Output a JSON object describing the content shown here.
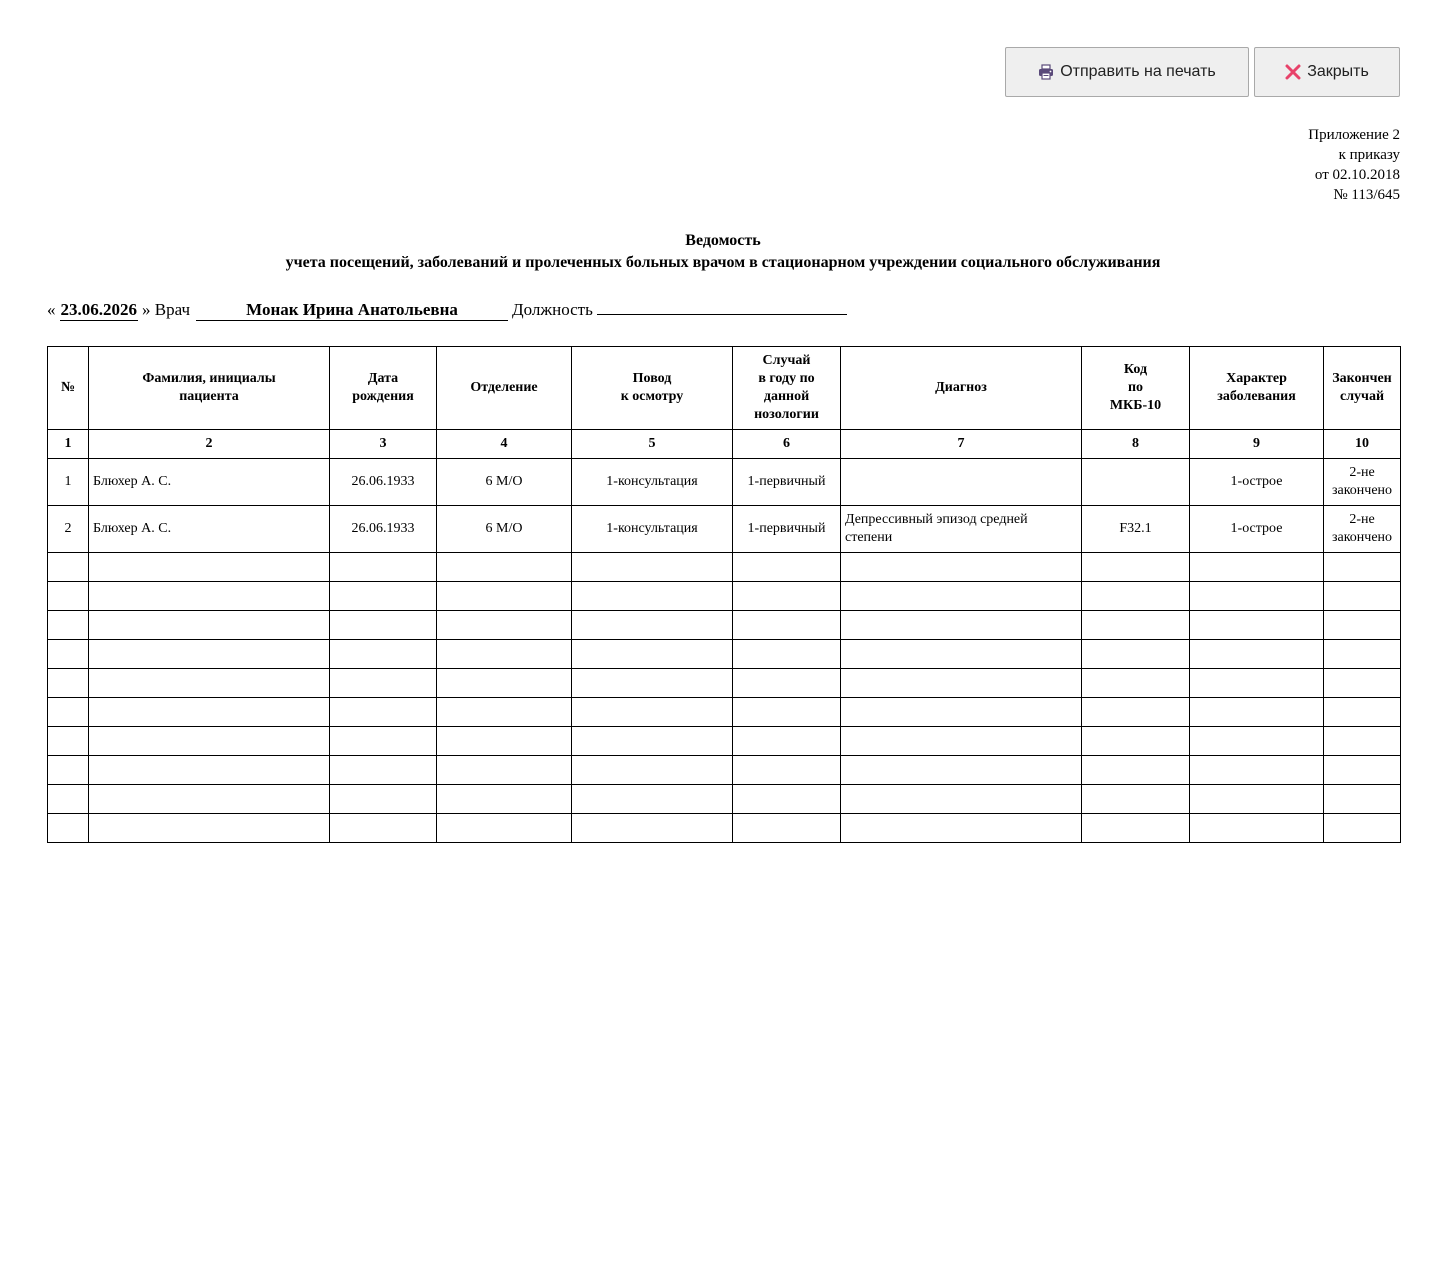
{
  "toolbar": {
    "print_label": "Отправить на печать",
    "close_label": "Закрыть"
  },
  "appendix": {
    "line1": "Приложение 2",
    "line2": "к приказу",
    "line3": "от 02.10.2018",
    "line4": "№ 113/645"
  },
  "title": {
    "main": "Ведомость",
    "sub": "учета посещений, заболеваний и пролеченных больных врачом в стационарном учреждении социального обслуживания"
  },
  "meta": {
    "quote_open": "«",
    "date": "23.06.2026",
    "quote_close_label": "» Врач",
    "doctor": "Монак Ирина Анатольевна",
    "position_label": "Должность",
    "position": ""
  },
  "table": {
    "headers": [
      "№",
      "Фамилия, инициалы\nпациента",
      "Дата\nрождения",
      "Отделение",
      "Повод\nк осмотру",
      "Случай\nв году по\nданной\nнозологии",
      "Диагноз",
      "Код\nпо\nМКБ-10",
      "Характер\nзаболевания",
      "Закончен\nслучай"
    ],
    "col_numbers": [
      "1",
      "2",
      "3",
      "4",
      "5",
      "6",
      "7",
      "8",
      "9",
      "10"
    ],
    "rows": [
      {
        "num": "1",
        "patient": "Блюхер А. С.",
        "birth": "26.06.1933",
        "dept": "6 М/О",
        "reason": "1-консультация",
        "case_year": "1-первичный",
        "diagnosis": "",
        "icd": "",
        "character": "1-острое",
        "finished": "2-не закончено"
      },
      {
        "num": "2",
        "patient": "Блюхер А. С.",
        "birth": "26.06.1933",
        "dept": "6 М/О",
        "reason": "1-консультация",
        "case_year": "1-первичный",
        "diagnosis": "Депрессивный эпизод средней степени",
        "icd": "F32.1",
        "character": "1-острое",
        "finished": "2-не закончено"
      }
    ],
    "empty_rows": 10
  }
}
